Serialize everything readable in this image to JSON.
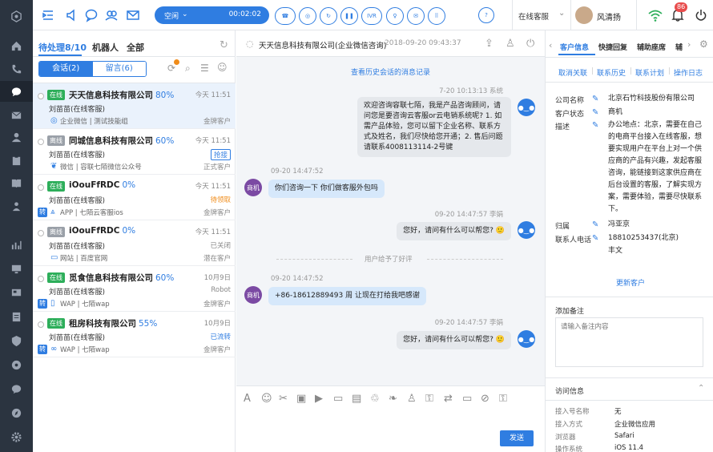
{
  "topbar": {
    "status": "空闲",
    "timer": "00:02:02",
    "ivr_label": "IVR",
    "agent_status": "在线客服",
    "user_name": "风清扬",
    "notify_count": "86"
  },
  "queue": {
    "tabs": [
      "待处理8/10",
      "机器人",
      "全部"
    ],
    "seg": [
      "会话(2)",
      "留言(6)"
    ],
    "rows": [
      {
        "badge": "在线",
        "badge_color": "#2dae5a",
        "company": "天天信息科技有限公司",
        "pct": "80%",
        "time": "今天 11:51",
        "agent": "刘苗苗(在线客服)",
        "stat": "",
        "channel": "企业微信 | 测试技能组",
        "ctype": "金牌客户",
        "zhuan": ""
      },
      {
        "badge": "离线",
        "badge_color": "#9aa0a8",
        "company": "同城信息科技有限公司",
        "pct": "60%",
        "time": "今天 11:51",
        "agent": "刘苗苗(在线客服)",
        "stat": "抢接",
        "channel": "微信 | 容联七陌微信公众号",
        "ctype": "正式客户",
        "zhuan": ""
      },
      {
        "badge": "在线",
        "badge_color": "#2dae5a",
        "company": "iOouFfRDC",
        "pct": "0%",
        "time": "今天 11:51",
        "agent": "刘苗苗(在线客服)",
        "stat": "待领取",
        "channel": "APP | 七陌云客服ios",
        "ctype": "金牌客户",
        "zhuan": "转"
      },
      {
        "badge": "离线",
        "badge_color": "#9aa0a8",
        "company": "iOouFfRDC",
        "pct": "0%",
        "time": "今天 11:51",
        "agent": "刘苗苗(在线客服)",
        "stat": "已关闭",
        "channel": "网站 | 百度官网",
        "ctype": "潜在客户",
        "zhuan": ""
      },
      {
        "badge": "在线",
        "badge_color": "#2dae5a",
        "company": "觅食信息科技有限公司",
        "pct": "60%",
        "time": "10月9日",
        "agent": "刘苗苗(在线客服)",
        "stat": "Robot",
        "channel": "WAP | 七陌wap",
        "ctype": "金牌客户",
        "zhuan": "转"
      },
      {
        "badge": "在线",
        "badge_color": "#2dae5a",
        "company": "租房科技有限公司",
        "pct": "55%",
        "time": "10月9日",
        "agent": "刘苗苗(在线客服)",
        "stat": "已流转",
        "channel": "WAP | 七陌wap",
        "ctype": "金牌客户",
        "zhuan": "转"
      }
    ]
  },
  "chat": {
    "title": "天天信息科技有限公司(企业微信咨询)",
    "title_time": "2018-09-20 09:43:37",
    "history_link": "查看历史会话的消息记录",
    "m1_meta": "7-20  10:13:13  系统",
    "m1": "欢迎咨询容联七陌，我是产品咨询顾问，请问您是要咨询云客服or云电销系统呢? 1. 如需产品体验，您可以留下企业名称、联系方式及姓名，我们尽快给您开通；2. 售后问题请联系4008113114-2号键",
    "m2_meta": "09-20  14:47:52",
    "m2_avatar": "商机",
    "m2": "你们咨询一下 你们做客服外包吗",
    "m3_meta": "09-20  14:47:57  李娟",
    "m3": "您好，请问有什么可以帮您? 🙂",
    "divider": "用户给予了好评",
    "m4_meta": "09-20  14:47:52",
    "m4_avatar": "商机",
    "m4": "+86-18612889493 周 让现在打给我吧感谢",
    "m5_meta": "09-20  14:47:57  李娟",
    "m5": "您好，请问有什么可以帮您? 🙂",
    "send": "发送"
  },
  "info": {
    "tabs": [
      "客户信息",
      "快捷回复",
      "辅助座席",
      "辅"
    ],
    "links": [
      "取消关联",
      "联系历史",
      "联系计划",
      "操作日志"
    ],
    "company_label": "公司名称",
    "company": "北京石竹科技股份有限公司",
    "status_label": "客户状态",
    "status": "商机",
    "desc_label": "描述",
    "desc": "办公地点：北京，需要在自己的电商平台接入在线客服，想要实现用户在平台上对一个供应商的产品有兴趣，发起客服咨询，能链接到这家供应商在后台设置的客服，了解实现方案，需要体验，需要尽快联系下。",
    "owner_label": "归属",
    "owner": "冯亚京",
    "phone_label": "联系人电话",
    "phone": "18810253437(北京)",
    "phone2": "丰文",
    "more": "更新客户",
    "note_title": "添加备注",
    "note_placeholder": "请输入备注内容",
    "visit_title": "访问信息",
    "visit": [
      {
        "k": "接入号名称",
        "v": "无"
      },
      {
        "k": "接入方式",
        "v": "企业微信应用"
      },
      {
        "k": "浏览器",
        "v": "Safari"
      },
      {
        "k": "操作系统",
        "v": "iOS 11.4"
      }
    ]
  }
}
